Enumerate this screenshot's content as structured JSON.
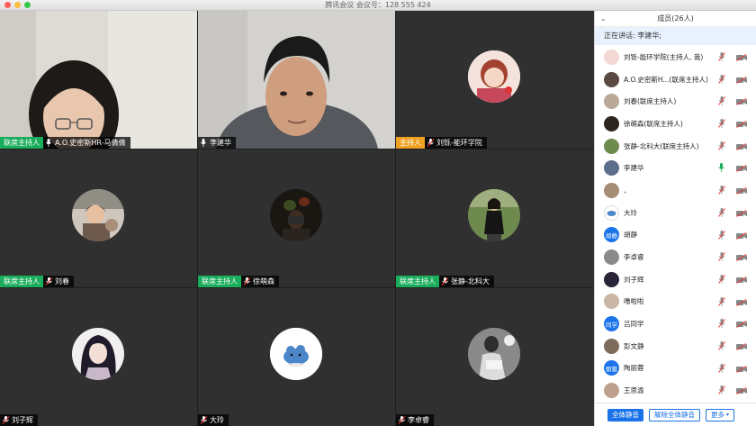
{
  "window": {
    "title": "腾讯会议 会议号：128 555 424"
  },
  "tiles": [
    {
      "role": "联席主持人",
      "name": "A.O.史密斯HR-马倩倩"
    },
    {
      "role": "",
      "name": "李建华"
    },
    {
      "role": "主持人",
      "name": "刘铄-能环学院"
    },
    {
      "role": "联席主持人",
      "name": "刘春"
    },
    {
      "role": "联席主持人",
      "name": "徐萌森"
    },
    {
      "role": "联席主持人",
      "name": "张静-北科大"
    },
    {
      "role": "",
      "name": "刘子辉"
    },
    {
      "role": "",
      "name": "大玲"
    },
    {
      "role": "",
      "name": "李卓睿"
    }
  ],
  "sidebar": {
    "header": "成员(26人)",
    "speaking": "正在讲话: 李建华;",
    "participants": [
      {
        "name": "刘铄-能环学院(主持人, 我)",
        "avatar_text": ""
      },
      {
        "name": "A.O.史密斯H...(联席主持人)",
        "avatar_text": ""
      },
      {
        "name": "刘春(联席主持人)",
        "avatar_text": ""
      },
      {
        "name": "徐萌森(联席主持人)",
        "avatar_text": ""
      },
      {
        "name": "张静-北科大(联席主持人)",
        "avatar_text": ""
      },
      {
        "name": "李建华",
        "avatar_text": ""
      },
      {
        "name": "、",
        "avatar_text": ""
      },
      {
        "name": "大玲",
        "avatar_text": ""
      },
      {
        "name": "胡静",
        "avatar_text": "胡静"
      },
      {
        "name": "李卓睿",
        "avatar_text": ""
      },
      {
        "name": "刘子辉",
        "avatar_text": ""
      },
      {
        "name": "噜啦啦",
        "avatar_text": ""
      },
      {
        "name": "吕同学",
        "avatar_text": "同学"
      },
      {
        "name": "彭文静",
        "avatar_text": ""
      },
      {
        "name": "陶丽蓉",
        "avatar_text": "丽蓉"
      },
      {
        "name": "王思渝",
        "avatar_text": ""
      }
    ],
    "footer": {
      "mute_all": "全体静音",
      "unmute_all": "解除全体静音",
      "more": "更多"
    }
  }
}
